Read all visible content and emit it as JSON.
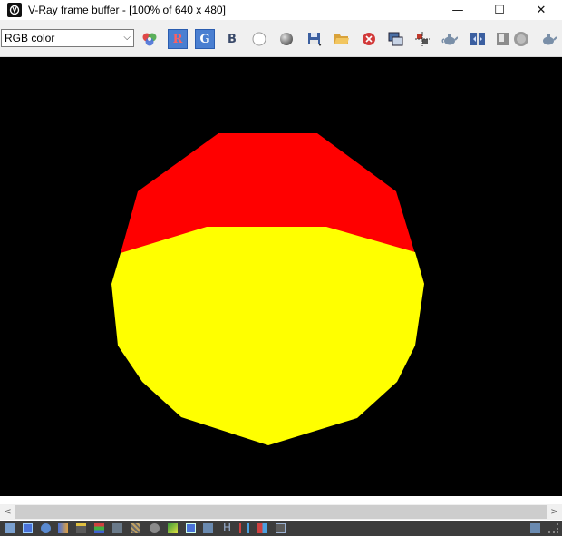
{
  "window": {
    "title": "V-Ray frame buffer - [100% of 640 x 480]",
    "minimize_glyph": "—",
    "maximize_glyph": "☐",
    "close_glyph": "✕"
  },
  "toolbar": {
    "channel_select": {
      "value": "RGB color",
      "chevron": "⌵"
    },
    "red_channel_label": "R",
    "green_channel_label": "G",
    "blue_channel_label": "B",
    "icons": [
      "color-swatches-icon",
      "red-channel-icon",
      "green-channel-icon",
      "blue-channel-icon",
      "white-circle-icon",
      "grey-sphere-icon",
      "save-icon",
      "open-folder-icon",
      "clear-icon",
      "duplicate-icon",
      "region-render-icon",
      "teapot-icon",
      "compare-icon",
      "image-icon",
      "stop-icon",
      "teapot-settings-icon"
    ]
  },
  "render": {
    "background_color": "#000000",
    "upper_color": "#ff0000",
    "lower_color": "#ffff00"
  },
  "scrollbar": {
    "left_arrow": "<",
    "right_arrow": ">"
  },
  "statusbar": {
    "bg_color": "#3c3c3c",
    "text_h": "H",
    "icons": [
      "display-icon",
      "color-corrections-icon",
      "info-icon",
      "lut-icon",
      "hsl-icon",
      "levels-icon",
      "curve-icon",
      "exposure-icon",
      "sun-icon",
      "lens-icon",
      "icc-icon",
      "ocio-icon",
      "h-icon",
      "stereo-icon",
      "channels-icon",
      "tile-icon",
      "show-history-icon",
      "resize-grip-icon"
    ]
  }
}
